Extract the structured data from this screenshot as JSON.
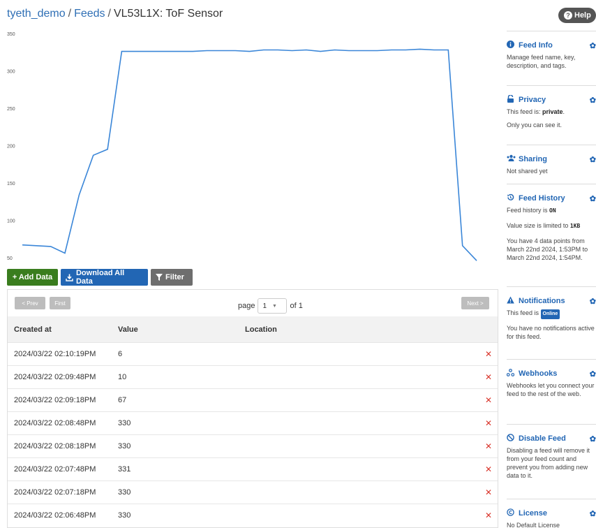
{
  "breadcrumb": {
    "user": "tyeth_demo",
    "sep": "/",
    "feeds": "Feeds",
    "current": "VL53L1X: ToF Sensor"
  },
  "help": {
    "label": "Help"
  },
  "chart_data": {
    "type": "line",
    "title": "",
    "xlabel": "",
    "ylabel": "",
    "ylim": [
      50,
      350
    ],
    "yticks": [
      50,
      100,
      150,
      200,
      250,
      300,
      350
    ],
    "color": "#3a86d8",
    "values": [
      68,
      67,
      66,
      57,
      135,
      188,
      196,
      327,
      327,
      327,
      327,
      327,
      327,
      328,
      328,
      328,
      327,
      329,
      329,
      328,
      329,
      327,
      329,
      328,
      328,
      328,
      329,
      329,
      330,
      329,
      329,
      67,
      47
    ]
  },
  "toolbar": {
    "add": "+ Add Data",
    "download": "Download All Data",
    "filter": "Filter"
  },
  "pager": {
    "prev": "< Prev",
    "first": "First",
    "page_word": "page",
    "page_value": "1",
    "of_label": "of 1",
    "next": "Next >"
  },
  "table": {
    "headers": {
      "created": "Created at",
      "value": "Value",
      "location": "Location"
    },
    "rows": [
      {
        "created": "2024/03/22 02:10:19PM",
        "value": "6",
        "location": ""
      },
      {
        "created": "2024/03/22 02:09:48PM",
        "value": "10",
        "location": ""
      },
      {
        "created": "2024/03/22 02:09:18PM",
        "value": "67",
        "location": ""
      },
      {
        "created": "2024/03/22 02:08:48PM",
        "value": "330",
        "location": ""
      },
      {
        "created": "2024/03/22 02:08:18PM",
        "value": "330",
        "location": ""
      },
      {
        "created": "2024/03/22 02:07:48PM",
        "value": "331",
        "location": ""
      },
      {
        "created": "2024/03/22 02:07:18PM",
        "value": "330",
        "location": ""
      },
      {
        "created": "2024/03/22 02:06:48PM",
        "value": "330",
        "location": ""
      }
    ],
    "delete_glyph": "✕"
  },
  "sidebar": {
    "feed_info": {
      "title": "Feed Info",
      "text": "Manage feed name, key, description, and tags."
    },
    "privacy": {
      "title": "Privacy",
      "text_prefix": "This feed is: ",
      "status": "private",
      "text_suffix": ".",
      "text2": "Only you can see it."
    },
    "sharing": {
      "title": "Sharing",
      "text": "Not shared yet"
    },
    "history": {
      "title": "Feed History",
      "line1_prefix": "Feed history is ",
      "line1_status": "ON",
      "line2_prefix": "Value size is limited to ",
      "line2_size": "1KB",
      "line3": "You have 4 data points from March 22nd 2024, 1:53PM to March 22nd 2024, 1:54PM."
    },
    "notifications": {
      "title": "Notifications",
      "line1_prefix": "This feed is ",
      "badge": "Online",
      "line2": "You have no notifications active for this feed."
    },
    "webhooks": {
      "title": "Webhooks",
      "text": "Webhooks let you connect your feed to the rest of the web."
    },
    "disable": {
      "title": "Disable Feed",
      "text": "Disabling a feed will remove it from your feed count and prevent you from adding new data to it."
    },
    "license": {
      "title": "License",
      "text": "No Default License"
    }
  }
}
